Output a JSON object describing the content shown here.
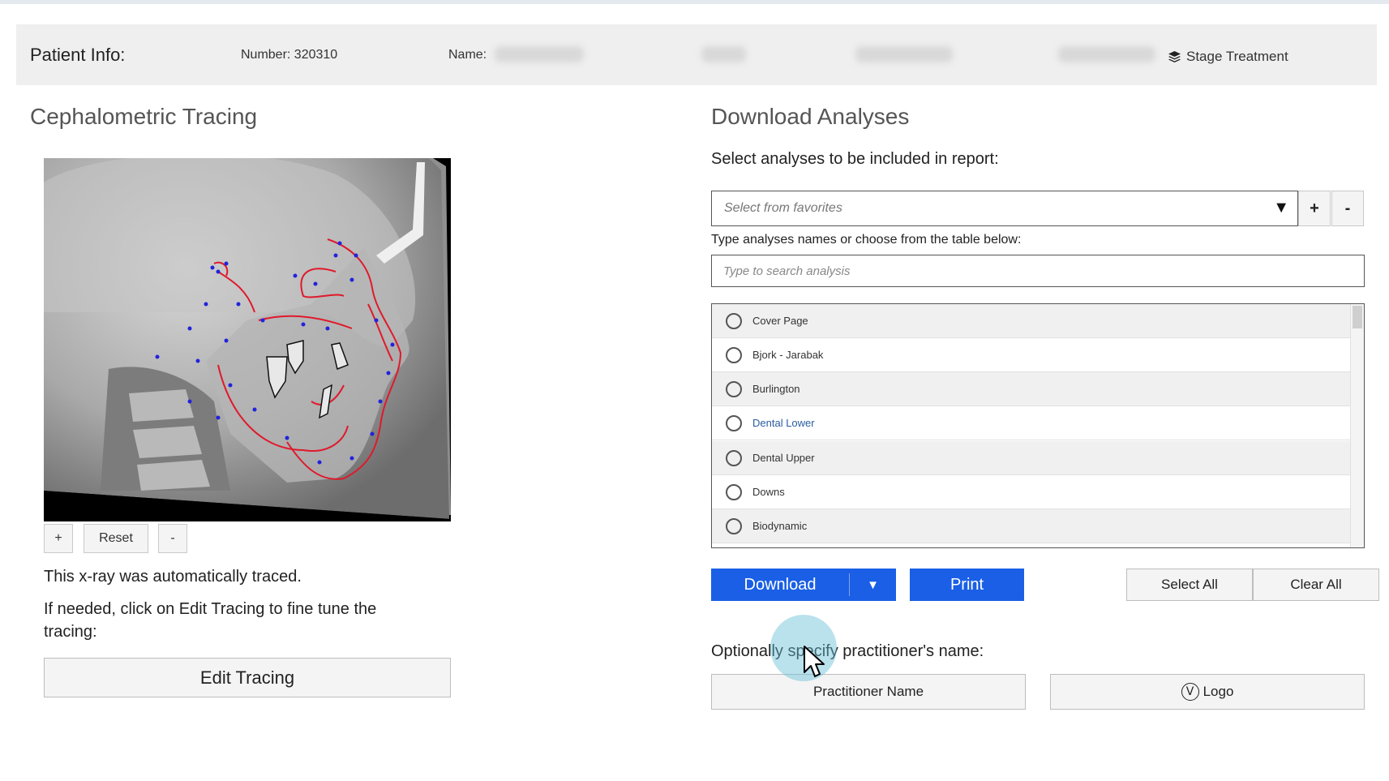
{
  "patient_info": {
    "label": "Patient Info:",
    "number": "Number: 320310",
    "name_label": "Name:",
    "stage_treatment": "Stage Treatment"
  },
  "left": {
    "title": "Cephalometric Tracing",
    "zoom_in": "+",
    "reset": "Reset",
    "zoom_out": "-",
    "auto_traced": "This x-ray was automatically traced.",
    "edit_hint": "If needed, click on Edit Tracing to fine tune the tracing:",
    "edit_button": "Edit Tracing"
  },
  "right": {
    "title": "Download Analyses",
    "select_prompt": "Select analyses to be included in report:",
    "favorites_placeholder": "Select from favorites",
    "favorites_add": "+",
    "favorites_remove": "-",
    "type_hint": "Type analyses names or choose from the table below:",
    "search_placeholder": "Type to search analysis",
    "analyses": [
      {
        "label": "Cover Page"
      },
      {
        "label": "Bjork - Jarabak"
      },
      {
        "label": "Burlington"
      },
      {
        "label": "Dental Lower"
      },
      {
        "label": "Dental Upper"
      },
      {
        "label": "Downs"
      },
      {
        "label": "Biodynamic"
      }
    ],
    "download": "Download",
    "print": "Print",
    "select_all": "Select All",
    "clear_all": "Clear All",
    "optional_prompt": "Optionally specify practitioner's name:",
    "practitioner_name": "Practitioner Name",
    "logo": "Logo"
  },
  "colors": {
    "primary_button": "#1a5fe6",
    "link_text": "#2a5d9f",
    "tracing_red": "#e0192b",
    "landmark_blue": "#2222dd"
  }
}
